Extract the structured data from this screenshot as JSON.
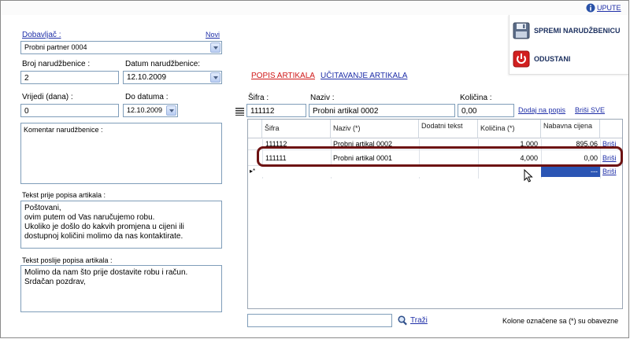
{
  "help_link": "UPUTE",
  "actions": {
    "save_label": "SPREMI NARUDŽBENICU",
    "cancel_label": "ODUSTANI"
  },
  "supplier": {
    "label": "Dobavljač :",
    "new_link": "Novi",
    "value": "Probni partner 0004"
  },
  "order_number": {
    "label": "Broj narudžbenice :",
    "value": "2"
  },
  "order_date": {
    "label": "Datum narudžbenice:",
    "value": "12.10.2009"
  },
  "valid_days": {
    "label": "Vrijedi (dana)   :",
    "value": "0"
  },
  "valid_until": {
    "label": "Do datuma :",
    "value": "12.10.2009"
  },
  "comment": {
    "label": "Komentar narudžbenice :",
    "value": ""
  },
  "text_before": {
    "label": "Tekst prije popisa artikala :",
    "value": "Poštovani,\novim putem od Vas naručujemo robu.\nUkoliko je došlo do kakvih promjena u cijeni ili\ndostupnoj količini molimo da nas kontaktirate."
  },
  "text_after": {
    "label": "Tekst poslije popisa artikala :",
    "value": "Molimo da nam što prije dostavite robu i račun.\nSrdačan pozdrav,"
  },
  "tabs": [
    {
      "label": "POPIS ARTIKALA"
    },
    {
      "label": "UČITAVANJE ARTIKALA"
    }
  ],
  "entry": {
    "sifra_label": "Šifra :",
    "sifra_value": "111112",
    "naziv_label": "Naziv :",
    "naziv_value": "Probni artikal 0002",
    "kolicina_label": "Količina :",
    "kolicina_value": "0,00",
    "add_link": "Dodaj na popis",
    "delete_all_link": "Briši SVE"
  },
  "grid": {
    "columns": [
      "Šifra",
      "Naziv (*)",
      "Dodatni tekst",
      "Količina (*)",
      "Nabavna cijena"
    ],
    "rows": [
      {
        "sifra": "111112",
        "naziv": "Probni artikal 0002",
        "tekst": "",
        "kolicina": "1,000",
        "cijena": "895,06",
        "action": "Briši"
      },
      {
        "sifra": "111111",
        "naziv": "Probni artikal 0001",
        "tekst": "",
        "kolicina": "4,000",
        "cijena": "0,00",
        "action": "Briši"
      }
    ],
    "new_row_marker": "▸*",
    "new_row_action": "Briši",
    "new_row_cijena": "---"
  },
  "footer": {
    "search_value": "",
    "search_label": "Traži",
    "note": "Kolone označene sa (*) su obavezne"
  }
}
